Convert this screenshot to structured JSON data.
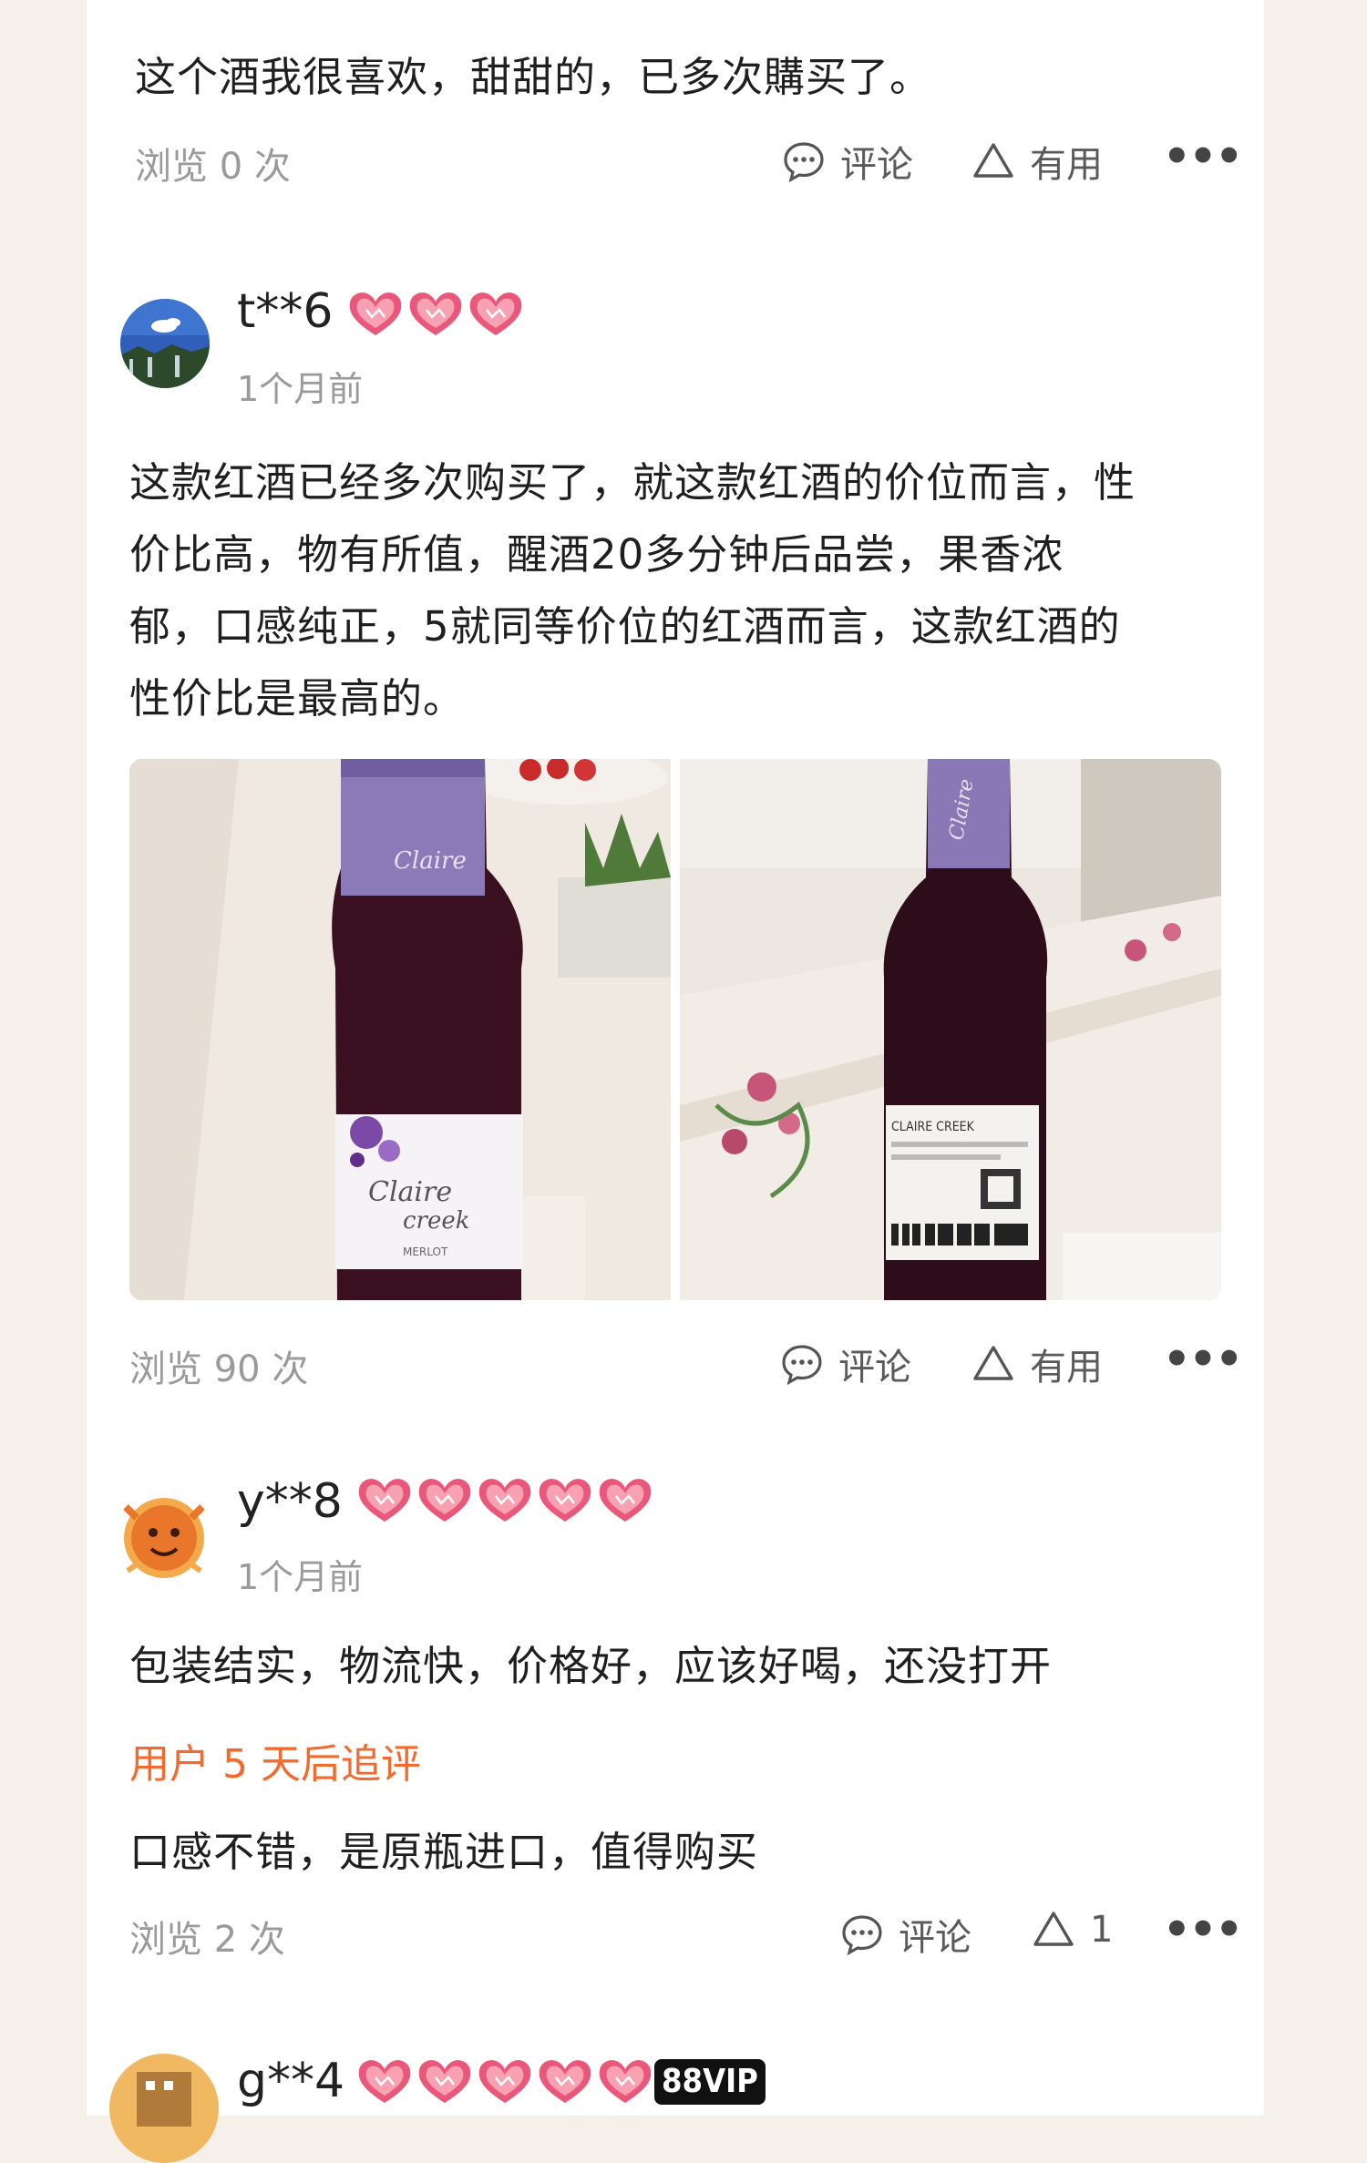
{
  "reviews": [
    {
      "text": "这个酒我很喜欢，甜甜的，已多次購买了。",
      "views": "浏览 0 次",
      "comment_label": "评论",
      "useful_label": "有用"
    },
    {
      "username": "t**6",
      "time": "1个月前",
      "hearts": 3,
      "text_lines": [
        "这款红酒已经多次购买了，就这款红酒的价位而言，性",
        "价比高，物有所值，醒酒20多分钟后品尝，果香浓",
        "郁，口感纯正，5就同等价位的红酒而言，这款红酒的",
        "性价比是最高的。"
      ],
      "photos": [
        {
          "label_front": "Claire creek",
          "label_sub": "MERLOT"
        },
        {
          "label_back": "CLAIRE CREEK梅尔诺葡萄酒",
          "volume": "净含量：750毫升"
        }
      ],
      "views": "浏览 90 次",
      "comment_label": "评论",
      "useful_label": "有用"
    },
    {
      "username": "y**8",
      "time": "1个月前",
      "hearts": 5,
      "text": "包装结实，物流快，价格好，应该好喝，还没打开",
      "followup_label": "用户 5 天后追评",
      "followup_text": "口感不错，是原瓶进口，值得购买",
      "views": "浏览 2 次",
      "comment_label": "评论",
      "useful_count": "1"
    },
    {
      "username": "g**4",
      "hearts": 5,
      "badge": "88VIP"
    }
  ],
  "colors": {
    "background": "#f6f0ea",
    "card": "#ffffff",
    "accent": "#f26a2e",
    "heart": "#e9587a"
  },
  "icons": [
    "comment-icon",
    "useful-triangle-icon",
    "more-dots-icon",
    "heart-icon"
  ]
}
